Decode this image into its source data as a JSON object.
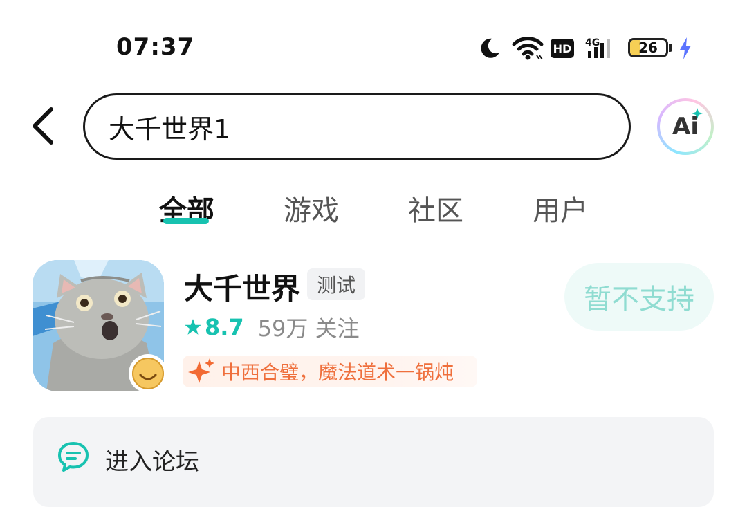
{
  "status_bar": {
    "time": "07:37",
    "network": "4G",
    "hd": "HD",
    "battery": "26",
    "icons": [
      "moon-icon",
      "wifi-icon",
      "hd-icon",
      "signal-4g-icon",
      "battery-icon",
      "charging-bolt-icon"
    ]
  },
  "search": {
    "query": "大千世界1",
    "ai_label": "Ai"
  },
  "tabs": [
    {
      "label": "全部",
      "active": true
    },
    {
      "label": "游戏",
      "active": false
    },
    {
      "label": "社区",
      "active": false
    },
    {
      "label": "用户",
      "active": false
    }
  ],
  "result": {
    "title": "大千世界",
    "tag": "测试",
    "rating": "8.7",
    "followers": "59万 关注",
    "promo": "中西合璧，魔法道术一锅炖",
    "action_label": "暂不支持"
  },
  "forum": {
    "label": "进入论坛"
  },
  "colors": {
    "accent": "#17c2b0",
    "promo": "#ef6f3c",
    "button_bg": "#eefaf8",
    "button_text": "#8fdcd1"
  }
}
